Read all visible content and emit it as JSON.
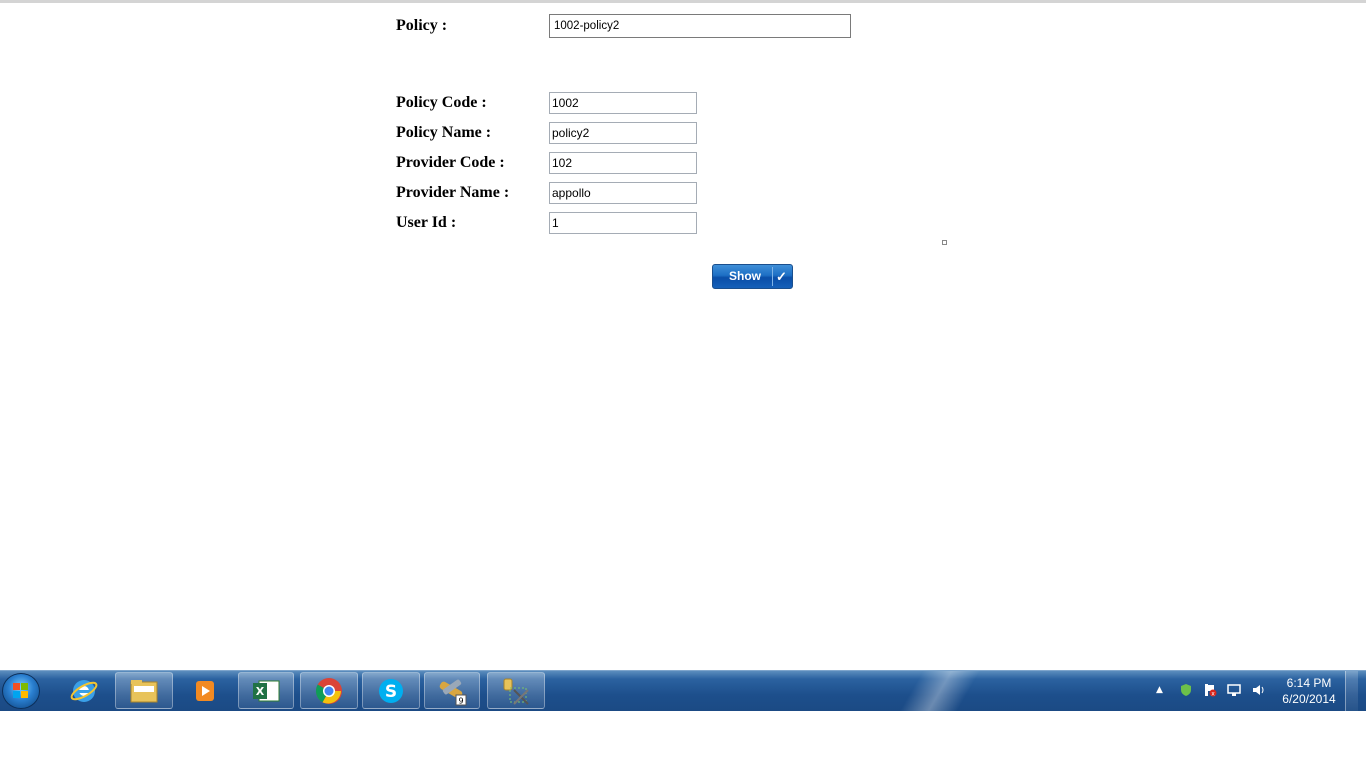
{
  "form": {
    "policy_label": "Policy :",
    "policy_value": "1002-policy2",
    "fields": [
      {
        "label": "Policy Code :",
        "value": "1002"
      },
      {
        "label": "Policy Name :",
        "value": "policy2"
      },
      {
        "label": "Provider Code :",
        "value": "102"
      },
      {
        "label": "Provider Name :",
        "value": "appollo"
      },
      {
        "label": "User Id :",
        "value": "1"
      }
    ],
    "show_button_label": "Show",
    "show_button_icon": "check-icon"
  },
  "taskbar": {
    "pinned": [
      {
        "name": "internet-explorer-icon"
      },
      {
        "name": "windows-explorer-icon"
      },
      {
        "name": "media-player-icon"
      },
      {
        "name": "excel-icon"
      },
      {
        "name": "chrome-icon"
      },
      {
        "name": "skype-icon"
      },
      {
        "name": "tools-icon",
        "badge": "9"
      },
      {
        "name": "sql-tools-icon"
      }
    ],
    "tray_icons": [
      "shield-icon",
      "action-center-icon",
      "network-icon",
      "volume-icon"
    ],
    "clock_time": "6:14 PM",
    "clock_date": "6/20/2014"
  },
  "colors": {
    "taskbar": "#1d4f8c",
    "button": "#1d6fc4"
  }
}
